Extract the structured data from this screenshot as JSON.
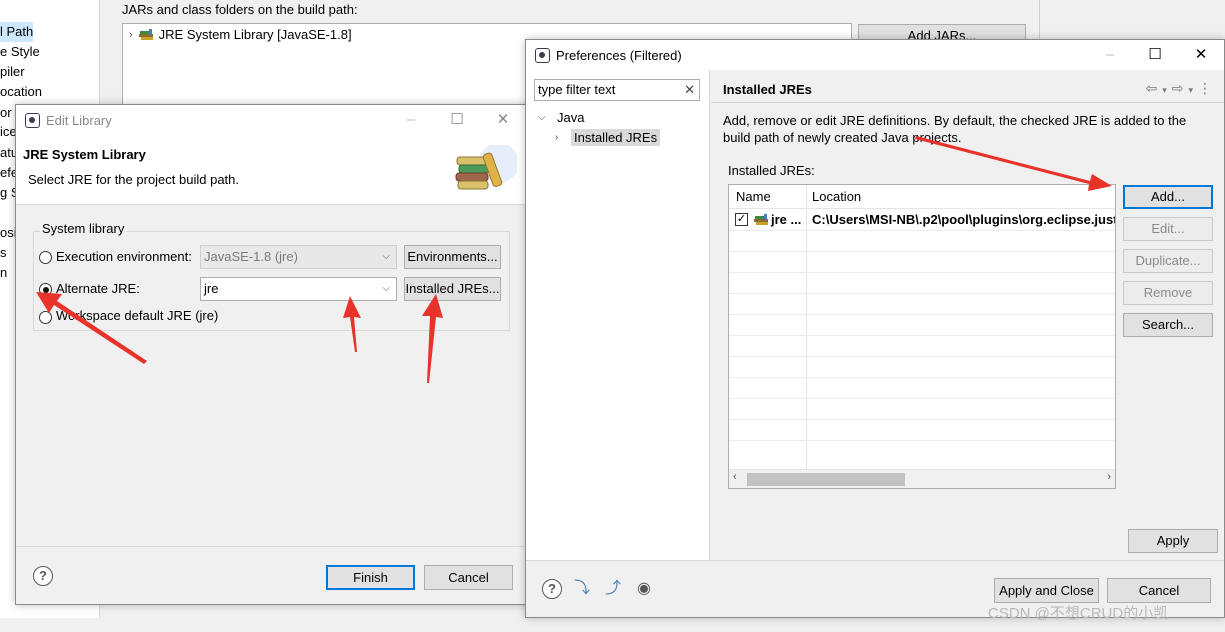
{
  "background": {
    "nav_items": [
      "l Path",
      "e Style",
      "piler",
      "ocation",
      "or",
      "ice",
      "atu",
      "efe",
      "g S",
      "osi",
      "s",
      "n"
    ],
    "jars_label": "JARs and class folders on the build path:",
    "tree_item": "JRE System Library [JavaSE-1.8]",
    "add_jars": "Add JARs..."
  },
  "edit_library": {
    "title": "Edit Library",
    "header_title": "JRE System Library",
    "header_desc": "Select JRE for the project build path.",
    "group_label": "System library",
    "exec_env_label": "Execution environment:",
    "exec_env_value": "JavaSE-1.8 (jre)",
    "environments_button": "Environments...",
    "alt_jre_label": "Alternate JRE:",
    "alt_jre_value": "jre",
    "installed_jres_button": "Installed JREs...",
    "workspace_label": "Workspace default JRE (jre)",
    "finish": "Finish",
    "cancel": "Cancel"
  },
  "preferences": {
    "title": "Preferences (Filtered)",
    "filter_placeholder": "type filter text",
    "tree": {
      "java": "Java",
      "installed_jres": "Installed JREs"
    },
    "page_title": "Installed JREs",
    "description": "Add, remove or edit JRE definitions. By default, the checked JRE is added to the build path of newly created Java projects.",
    "jres_label": "Installed JREs:",
    "columns": [
      "Name",
      "Location"
    ],
    "rows": [
      {
        "checked": true,
        "name": "jre ...",
        "location": "C:\\Users\\MSI-NB\\.p2\\pool\\plugins\\org.eclipse.just"
      }
    ],
    "buttons": {
      "add": "Add...",
      "edit": "Edit...",
      "duplicate": "Duplicate...",
      "remove": "Remove",
      "search": "Search..."
    },
    "apply": "Apply",
    "apply_close": "Apply and Close",
    "cancel": "Cancel"
  },
  "colors": {
    "accent": "#0078d7",
    "arrow": "#e8332b",
    "selection": "#cce8ff"
  },
  "watermark": "CSDN @不想CRUD的小凯"
}
